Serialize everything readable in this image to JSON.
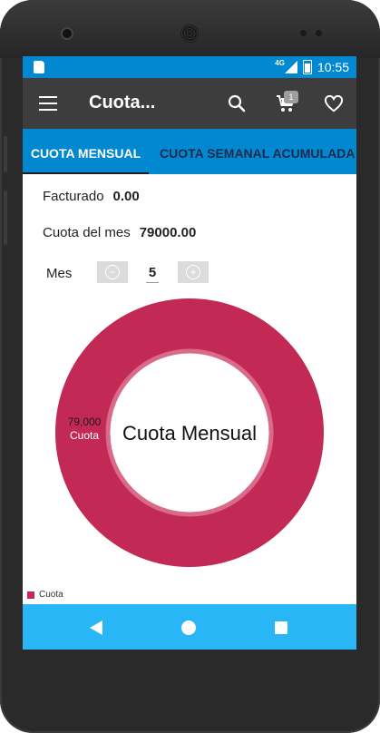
{
  "status_bar": {
    "network": "4G",
    "time": "10:55"
  },
  "toolbar": {
    "title": "Cuota...",
    "cart_count": "1"
  },
  "tabs": [
    {
      "label": "CUOTA MENSUAL",
      "selected": true
    },
    {
      "label": "CUOTA SEMANAL ACUMULADA",
      "selected": false
    }
  ],
  "summary": {
    "facturado_label": "Facturado",
    "facturado_value": "0.00",
    "cuota_label": "Cuota del mes",
    "cuota_value": "79000.00"
  },
  "month_selector": {
    "label": "Mes",
    "value": "5",
    "minus_icon": "−",
    "plus_icon": "+"
  },
  "chart_data": {
    "type": "pie",
    "donut": true,
    "center_text": "Cuota Mensual",
    "slices": [
      {
        "label": "Cuota",
        "value": 79000,
        "value_label": "79,000",
        "color": "#c22a55"
      }
    ],
    "legend": {
      "placement": "bottom-left",
      "entries": [
        "Cuota"
      ]
    }
  },
  "colors": {
    "status_bar": "#0288d1",
    "toolbar": "#3d3d3d",
    "tabs": "#0288d1",
    "nav_bar": "#29b6f6",
    "slice": "#c22a55"
  }
}
